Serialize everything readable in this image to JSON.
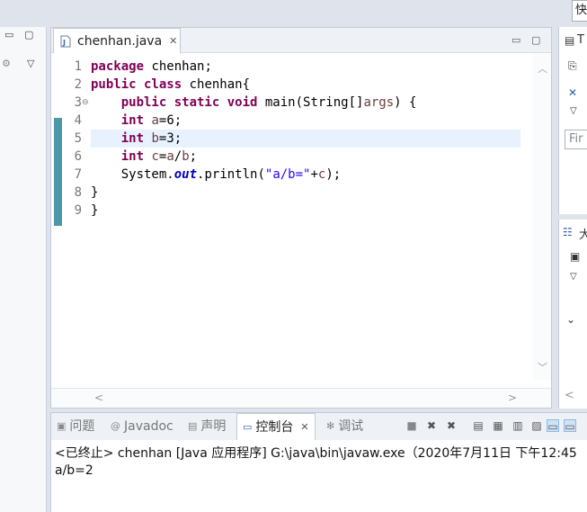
{
  "top_right_button": "快",
  "editor": {
    "tab_label": "chenhan.java",
    "line_numbers": [
      "1",
      "2",
      "3",
      "4",
      "5",
      "6",
      "7",
      "8",
      "9"
    ],
    "code": {
      "l1_kw": "package",
      "l1_rest": " chenhan;",
      "l2_kw": "public class",
      "l2_rest": " chenhan{",
      "l3_indent": "    ",
      "l3_kw": "public static void",
      "l3_mid": " main(String[]",
      "l3_var": "args",
      "l3_end": ") {",
      "l4_indent": "    ",
      "l4_kw": "int",
      "l4_sp": " ",
      "l4_var": "a",
      "l4_end": "=6;",
      "l5_indent": "    ",
      "l5_kw": "int",
      "l5_sp": " ",
      "l5_var": "b",
      "l5_end": "=3;",
      "l6_indent": "    ",
      "l6_kw": "int",
      "l6_sp": " ",
      "l6_var": "c",
      "l6_eq": "=",
      "l6_a": "a",
      "l6_sl": "/",
      "l6_b": "b",
      "l6_end": ";",
      "l7_indent": "    ",
      "l7_a": "System.",
      "l7_fld": "out",
      "l7_b": ".println(",
      "l7_str": "\"a/b=\"",
      "l7_c": "+",
      "l7_var": "c",
      "l7_end": ");",
      "l8": "}",
      "l9": "}"
    }
  },
  "right_panel": {
    "top_label": "T",
    "find_placeholder": "Fir",
    "mid_label": "大"
  },
  "console": {
    "tabs": {
      "problems": "问题",
      "javadoc": "Javadoc",
      "declaration": "声明",
      "console": "控制台",
      "debug": "调试"
    },
    "header_line": "<已终止> chenhan [Java 应用程序] G:\\java\\bin\\javaw.exe（2020年7月11日 下午12:45",
    "output": "a/b=2"
  },
  "colors": {
    "keyword": "#7f0055",
    "string": "#2a00ff",
    "local_var": "#6a3e3e",
    "static_field": "#0000c0",
    "current_line": "#e8f2fe",
    "change_bar": "#4e97a8"
  }
}
